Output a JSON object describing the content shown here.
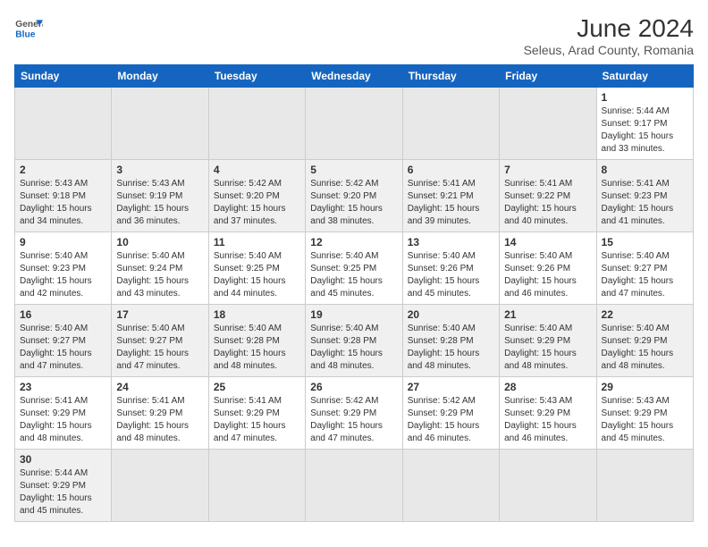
{
  "header": {
    "logo_general": "General",
    "logo_blue": "Blue",
    "month": "June 2024",
    "location": "Seleus, Arad County, Romania"
  },
  "weekdays": [
    "Sunday",
    "Monday",
    "Tuesday",
    "Wednesday",
    "Thursday",
    "Friday",
    "Saturday"
  ],
  "weeks": [
    [
      {
        "day": "",
        "info": ""
      },
      {
        "day": "",
        "info": ""
      },
      {
        "day": "",
        "info": ""
      },
      {
        "day": "",
        "info": ""
      },
      {
        "day": "",
        "info": ""
      },
      {
        "day": "",
        "info": ""
      },
      {
        "day": "1",
        "info": "Sunrise: 5:44 AM\nSunset: 9:17 PM\nDaylight: 15 hours\nand 33 minutes."
      }
    ],
    [
      {
        "day": "2",
        "info": "Sunrise: 5:43 AM\nSunset: 9:18 PM\nDaylight: 15 hours\nand 34 minutes."
      },
      {
        "day": "3",
        "info": "Sunrise: 5:43 AM\nSunset: 9:19 PM\nDaylight: 15 hours\nand 36 minutes."
      },
      {
        "day": "4",
        "info": "Sunrise: 5:42 AM\nSunset: 9:20 PM\nDaylight: 15 hours\nand 37 minutes."
      },
      {
        "day": "5",
        "info": "Sunrise: 5:42 AM\nSunset: 9:20 PM\nDaylight: 15 hours\nand 38 minutes."
      },
      {
        "day": "6",
        "info": "Sunrise: 5:41 AM\nSunset: 9:21 PM\nDaylight: 15 hours\nand 39 minutes."
      },
      {
        "day": "7",
        "info": "Sunrise: 5:41 AM\nSunset: 9:22 PM\nDaylight: 15 hours\nand 40 minutes."
      },
      {
        "day": "8",
        "info": "Sunrise: 5:41 AM\nSunset: 9:23 PM\nDaylight: 15 hours\nand 41 minutes."
      }
    ],
    [
      {
        "day": "9",
        "info": "Sunrise: 5:40 AM\nSunset: 9:23 PM\nDaylight: 15 hours\nand 42 minutes."
      },
      {
        "day": "10",
        "info": "Sunrise: 5:40 AM\nSunset: 9:24 PM\nDaylight: 15 hours\nand 43 minutes."
      },
      {
        "day": "11",
        "info": "Sunrise: 5:40 AM\nSunset: 9:25 PM\nDaylight: 15 hours\nand 44 minutes."
      },
      {
        "day": "12",
        "info": "Sunrise: 5:40 AM\nSunset: 9:25 PM\nDaylight: 15 hours\nand 45 minutes."
      },
      {
        "day": "13",
        "info": "Sunrise: 5:40 AM\nSunset: 9:26 PM\nDaylight: 15 hours\nand 45 minutes."
      },
      {
        "day": "14",
        "info": "Sunrise: 5:40 AM\nSunset: 9:26 PM\nDaylight: 15 hours\nand 46 minutes."
      },
      {
        "day": "15",
        "info": "Sunrise: 5:40 AM\nSunset: 9:27 PM\nDaylight: 15 hours\nand 47 minutes."
      }
    ],
    [
      {
        "day": "16",
        "info": "Sunrise: 5:40 AM\nSunset: 9:27 PM\nDaylight: 15 hours\nand 47 minutes."
      },
      {
        "day": "17",
        "info": "Sunrise: 5:40 AM\nSunset: 9:27 PM\nDaylight: 15 hours\nand 47 minutes."
      },
      {
        "day": "18",
        "info": "Sunrise: 5:40 AM\nSunset: 9:28 PM\nDaylight: 15 hours\nand 48 minutes."
      },
      {
        "day": "19",
        "info": "Sunrise: 5:40 AM\nSunset: 9:28 PM\nDaylight: 15 hours\nand 48 minutes."
      },
      {
        "day": "20",
        "info": "Sunrise: 5:40 AM\nSunset: 9:28 PM\nDaylight: 15 hours\nand 48 minutes."
      },
      {
        "day": "21",
        "info": "Sunrise: 5:40 AM\nSunset: 9:29 PM\nDaylight: 15 hours\nand 48 minutes."
      },
      {
        "day": "22",
        "info": "Sunrise: 5:40 AM\nSunset: 9:29 PM\nDaylight: 15 hours\nand 48 minutes."
      }
    ],
    [
      {
        "day": "23",
        "info": "Sunrise: 5:41 AM\nSunset: 9:29 PM\nDaylight: 15 hours\nand 48 minutes."
      },
      {
        "day": "24",
        "info": "Sunrise: 5:41 AM\nSunset: 9:29 PM\nDaylight: 15 hours\nand 48 minutes."
      },
      {
        "day": "25",
        "info": "Sunrise: 5:41 AM\nSunset: 9:29 PM\nDaylight: 15 hours\nand 47 minutes."
      },
      {
        "day": "26",
        "info": "Sunrise: 5:42 AM\nSunset: 9:29 PM\nDaylight: 15 hours\nand 47 minutes."
      },
      {
        "day": "27",
        "info": "Sunrise: 5:42 AM\nSunset: 9:29 PM\nDaylight: 15 hours\nand 46 minutes."
      },
      {
        "day": "28",
        "info": "Sunrise: 5:43 AM\nSunset: 9:29 PM\nDaylight: 15 hours\nand 46 minutes."
      },
      {
        "day": "29",
        "info": "Sunrise: 5:43 AM\nSunset: 9:29 PM\nDaylight: 15 hours\nand 45 minutes."
      }
    ],
    [
      {
        "day": "30",
        "info": "Sunrise: 5:44 AM\nSunset: 9:29 PM\nDaylight: 15 hours\nand 45 minutes."
      },
      {
        "day": "",
        "info": ""
      },
      {
        "day": "",
        "info": ""
      },
      {
        "day": "",
        "info": ""
      },
      {
        "day": "",
        "info": ""
      },
      {
        "day": "",
        "info": ""
      },
      {
        "day": "",
        "info": ""
      }
    ]
  ]
}
